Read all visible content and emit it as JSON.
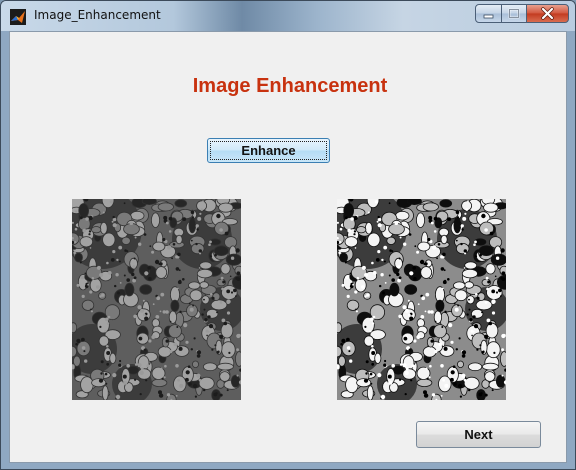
{
  "window": {
    "title": "Image_Enhancement",
    "app_icon": "matlab-icon",
    "controls": {
      "minimize_icon": "minimize-icon",
      "maximize_icon": "maximize-icon",
      "close_icon": "close-icon"
    }
  },
  "main": {
    "heading": "Image Enhancement",
    "enhance_label": "Enhance",
    "next_label": "Next"
  },
  "images": {
    "original": "grayscale-cell-micrograph-original",
    "enhanced": "grayscale-cell-micrograph-enhanced"
  },
  "colors": {
    "heading": "#c8320f",
    "client_bg": "#f0f0f0",
    "close_button": "#c23a1f"
  }
}
